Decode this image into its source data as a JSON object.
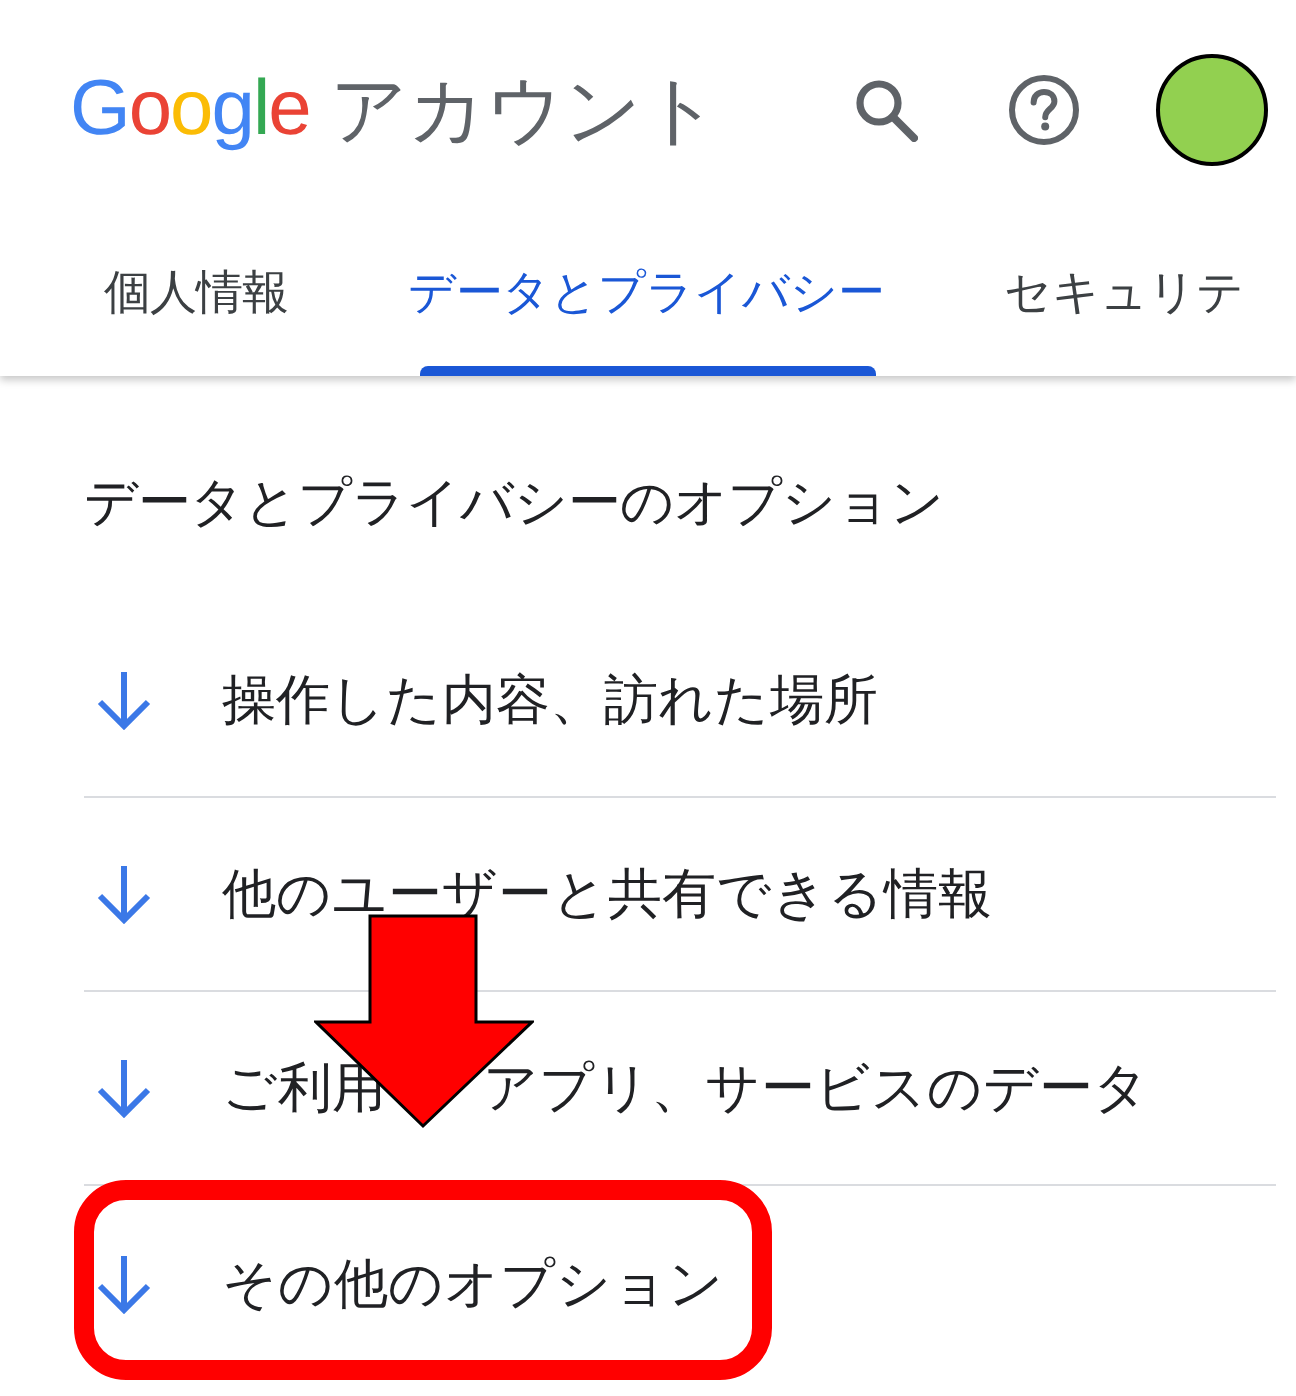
{
  "header": {
    "logo": "Google",
    "title": "アカウント"
  },
  "tabs": [
    {
      "label": "個人情報",
      "selected": false
    },
    {
      "label": "データとプライバシー",
      "selected": true
    },
    {
      "label": "セキュリテ",
      "selected": false
    }
  ],
  "section": {
    "heading": "データとプライバシーのオプション",
    "options": [
      {
        "label": "操作した内容、訪れた場所",
        "highlighted": false
      },
      {
        "label": "他のユーザーと共有できる情報",
        "highlighted": false
      },
      {
        "label": "ご利用 アプリ、サービスのデータ",
        "highlighted": false
      },
      {
        "label": "その他のオプション",
        "highlighted": true
      }
    ]
  }
}
